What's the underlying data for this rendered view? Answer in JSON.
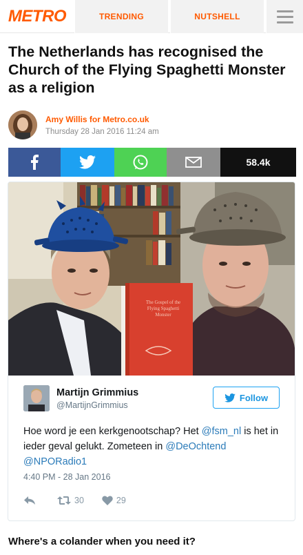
{
  "nav": {
    "logo": "METRO",
    "trending": "TRENDING",
    "nutshell": "NUTSHELL",
    "menu_icon": "hamburger-icon"
  },
  "article": {
    "headline": "The Netherlands has recognised the Church of the Flying Spaghetti Monster as a religion",
    "author": "Amy Willis for Metro.co.uk",
    "date": "Thursday 28 Jan 2016 11:24 am",
    "caption": "Where's a colander when you need it?"
  },
  "share": {
    "facebook_icon": "facebook-icon",
    "twitter_icon": "twitter-icon",
    "whatsapp_icon": "whatsapp-icon",
    "email_icon": "email-icon",
    "count": "58.4k",
    "colors": {
      "facebook": "#3b5998",
      "twitter": "#1da1f2",
      "whatsapp": "#4ed254",
      "email": "#8f8f8f",
      "count_bg": "#111111"
    }
  },
  "tweet": {
    "name": "Martijn Grimmius",
    "handle": "@MartijnGrimmius",
    "follow_label": "Follow",
    "text_1": "Hoe word je een kerkgenootschap? Het ",
    "mention_1": "@fsm_nl",
    "text_2": " is het in ieder geval gelukt. Zometeen in ",
    "mention_2": "@DeOchtend",
    "text_3": " ",
    "mention_3": "@NPORadio1",
    "timestamp": "4:40 PM - 28 Jan 2016",
    "retweets": "30",
    "likes": "29",
    "book_text": "The Gospel of the Flying Spaghetti Monster"
  },
  "brand_color": "#ff5a00"
}
